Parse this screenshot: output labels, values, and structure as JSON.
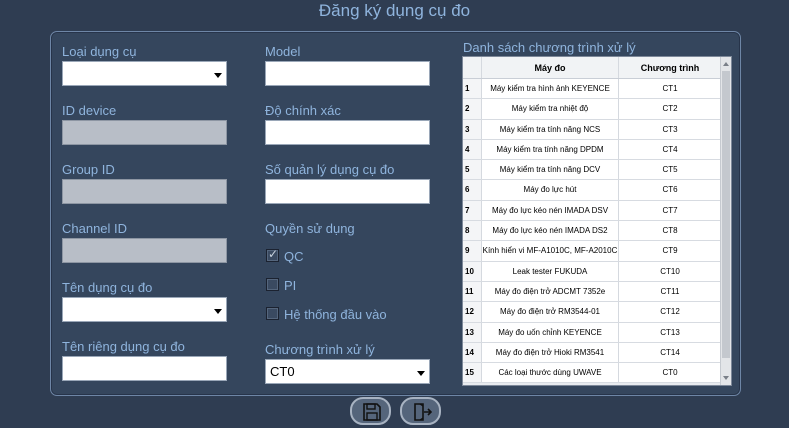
{
  "window": {
    "title": "Đăng ký dụng cụ đo"
  },
  "form": {
    "loai_dung_cu": {
      "label": "Loại dụng cụ",
      "value": ""
    },
    "model": {
      "label": "Model",
      "value": ""
    },
    "id_device": {
      "label": "ID device",
      "value": ""
    },
    "do_chinh_xac": {
      "label": "Độ chính xác",
      "value": ""
    },
    "group_id": {
      "label": "Group ID",
      "value": ""
    },
    "so_quan_ly": {
      "label": "Số quản lý dụng cụ đo",
      "value": ""
    },
    "channel_id": {
      "label": "Channel ID",
      "value": ""
    },
    "quyen_su_dung": {
      "label": "Quyền sử dụng"
    },
    "ten_dung_cu": {
      "label": "Tên dụng cụ đo",
      "value": ""
    },
    "ten_rieng": {
      "label": "Tên riêng dụng cụ đo",
      "value": ""
    },
    "chuong_trinh": {
      "label": "Chương trình xử lý",
      "value": "CT0"
    },
    "permissions": [
      {
        "label": "QC",
        "checked": true
      },
      {
        "label": "PI",
        "checked": false
      },
      {
        "label": "Hệ thống đầu vào",
        "checked": false
      }
    ]
  },
  "list": {
    "title": "Danh sách chương trình xử lý",
    "columns": [
      "",
      "Máy đo",
      "Chương trình"
    ],
    "rows": [
      {
        "no": "1",
        "device": "Máy kiểm tra hình ảnh KEYENCE",
        "program": "CT1"
      },
      {
        "no": "2",
        "device": "Máy kiểm tra nhiệt độ",
        "program": "CT2"
      },
      {
        "no": "3",
        "device": "Máy kiểm tra tính năng NCS",
        "program": "CT3"
      },
      {
        "no": "4",
        "device": "Máy kiểm tra tính năng DPDM",
        "program": "CT4"
      },
      {
        "no": "5",
        "device": "Máy kiểm tra tính năng DCV",
        "program": "CT5"
      },
      {
        "no": "6",
        "device": "Máy đo lực hút",
        "program": "CT6"
      },
      {
        "no": "7",
        "device": "Máy đo lực kéo nén IMADA DSV",
        "program": "CT7"
      },
      {
        "no": "8",
        "device": "Máy đo lực kéo nén IMADA DS2",
        "program": "CT8"
      },
      {
        "no": "9",
        "device": "Kính hiển vi MF-A1010C, MF-A2010C",
        "program": "CT9"
      },
      {
        "no": "10",
        "device": "Leak tester FUKUDA",
        "program": "CT10"
      },
      {
        "no": "11",
        "device": "Máy đo điện trở ADCMT 7352e",
        "program": "CT11"
      },
      {
        "no": "12",
        "device": "Máy đo điện trở RM3544-01",
        "program": "CT12"
      },
      {
        "no": "13",
        "device": "Máy đo uốn chỉnh KEYENCE",
        "program": "CT13"
      },
      {
        "no": "14",
        "device": "Máy đo điện trở Hioki RM3541",
        "program": "CT14"
      },
      {
        "no": "15",
        "device": "Các loại thước dùng UWAVE",
        "program": "CT0"
      }
    ]
  },
  "icons": {
    "save": "save-icon",
    "exit": "exit-icon"
  }
}
